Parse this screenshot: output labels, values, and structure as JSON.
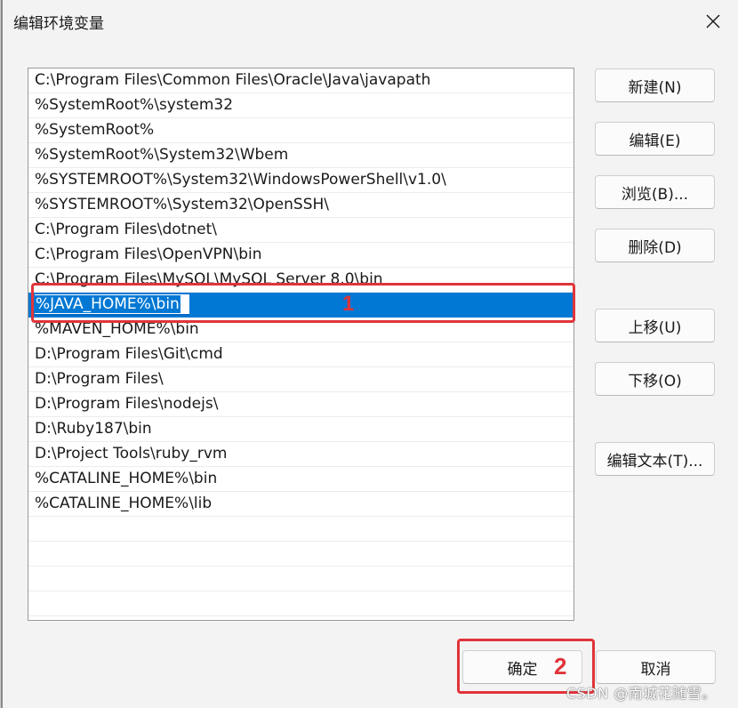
{
  "window": {
    "title": "编辑环境变量",
    "close_icon": "close-icon"
  },
  "list": {
    "items": [
      "C:\\Program Files\\Common Files\\Oracle\\Java\\javapath",
      "%SystemRoot%\\system32",
      "%SystemRoot%",
      "%SystemRoot%\\System32\\Wbem",
      "%SYSTEMROOT%\\System32\\WindowsPowerShell\\v1.0\\",
      "%SYSTEMROOT%\\System32\\OpenSSH\\",
      "C:\\Program Files\\dotnet\\",
      "C:\\Program Files\\OpenVPN\\bin",
      "C:\\Program Files\\MySQL\\MySQL Server 8.0\\bin",
      "%JAVA_HOME%\\bin",
      "%MAVEN_HOME%\\bin",
      "D:\\Program Files\\Git\\cmd",
      "D:\\Program Files\\",
      "D:\\Program Files\\nodejs\\",
      "D:\\Ruby187\\bin",
      "D:\\Project Tools\\ruby_rvm",
      "%CATALINE_HOME%\\bin",
      "%CATALINE_HOME%\\lib"
    ],
    "selected_index": 9
  },
  "buttons": {
    "new": "新建(N)",
    "edit": "编辑(E)",
    "browse": "浏览(B)...",
    "delete": "删除(D)",
    "move_up": "上移(U)",
    "move_down": "下移(O)",
    "edit_text": "编辑文本(T)...",
    "ok": "确定",
    "cancel": "取消"
  },
  "annotations": {
    "step1": "1",
    "step2": "2",
    "color": "#e0343a"
  },
  "watermark": "CSDN @南城花随雪。",
  "colors": {
    "selection": "#0078d4",
    "window_bg": "#f3f3f3"
  }
}
